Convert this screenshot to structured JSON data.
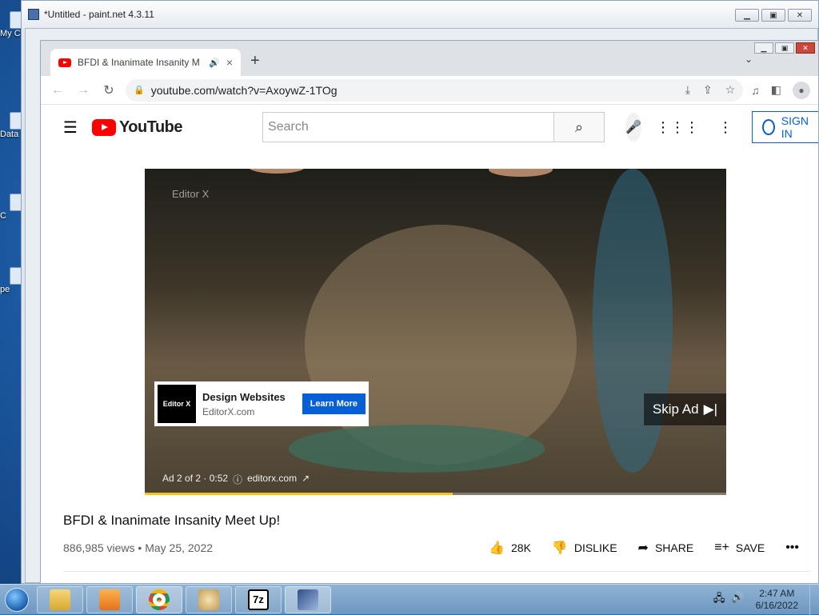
{
  "desktop": {
    "icons": [
      {
        "label": "My C"
      },
      {
        "label": "Data"
      },
      {
        "label": "C"
      },
      {
        "label": "pe"
      }
    ]
  },
  "paintnet": {
    "title": "*Untitled - paint.net 4.3.11"
  },
  "chrome": {
    "tab": {
      "title": "BFDI & Inanimate Insanity M",
      "audio_icon": "speaker-icon",
      "close": "×"
    },
    "new_tab": "+",
    "tab_search": "⌄",
    "address": {
      "url": "youtube.com/watch?v=AxoywZ-1TOg"
    }
  },
  "youtube": {
    "logo_text": "YouTube",
    "search": {
      "placeholder": "Search"
    },
    "sign_in": "SIGN IN",
    "video": {
      "watermark": "Editor X",
      "ad": {
        "logo": "Editor X",
        "title": "Design Websites",
        "domain": "EditorX.com",
        "cta": "Learn More"
      },
      "skip_label": "Skip Ad",
      "ad_info": "Ad 2 of 2 · 0:52",
      "ad_link": "editorx.com",
      "progress": 0.53
    },
    "title": "BFDI & Inanimate Insanity Meet Up!",
    "views": "886,985 views",
    "date": "May 25, 2022",
    "actions": {
      "like": "28K",
      "dislike": "DISLIKE",
      "share": "SHARE",
      "save": "SAVE"
    }
  },
  "taskbar": {
    "time": "2:47 AM",
    "date": "6/16/2022"
  }
}
